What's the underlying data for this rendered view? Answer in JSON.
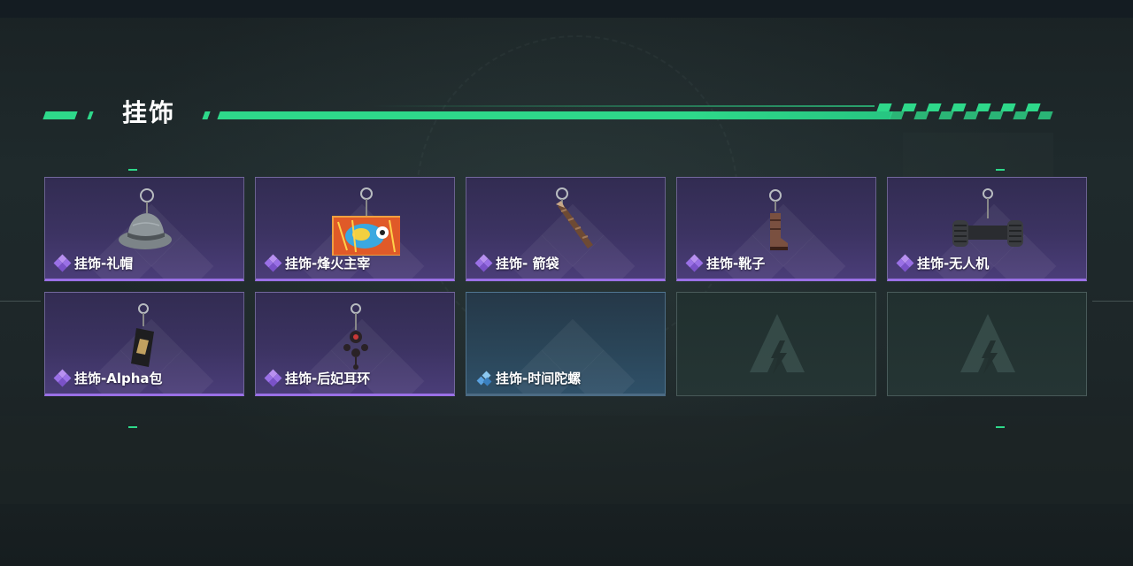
{
  "section": {
    "title": "挂饰"
  },
  "colors": {
    "accent": "#2ed88a",
    "rarity_purple": "#9a70e6",
    "rarity_blue": "#5aa2e0"
  },
  "items": [
    {
      "label": "挂饰-礼帽",
      "rarity": "purple",
      "icon": "fedora-hat-charm"
    },
    {
      "label": "挂饰-烽火主宰",
      "rarity": "purple",
      "icon": "graffiti-tag-charm"
    },
    {
      "label": "挂饰- 箭袋",
      "rarity": "purple",
      "icon": "quiver-charm"
    },
    {
      "label": "挂饰-靴子",
      "rarity": "purple",
      "icon": "boot-charm"
    },
    {
      "label": "挂饰-无人机",
      "rarity": "purple",
      "icon": "drone-charm"
    },
    {
      "label": "挂饰-Alpha包",
      "rarity": "purple",
      "icon": "alpha-pack-charm"
    },
    {
      "label": "挂饰-后妃耳环",
      "rarity": "purple",
      "icon": "earring-charm"
    },
    {
      "label": "挂饰-时间陀螺",
      "rarity": "blue",
      "icon": "time-top-charm"
    },
    {
      "label": "",
      "rarity": "empty",
      "icon": "empty-slot-logo-icon"
    },
    {
      "label": "",
      "rarity": "empty",
      "icon": "empty-slot-logo-icon"
    }
  ]
}
